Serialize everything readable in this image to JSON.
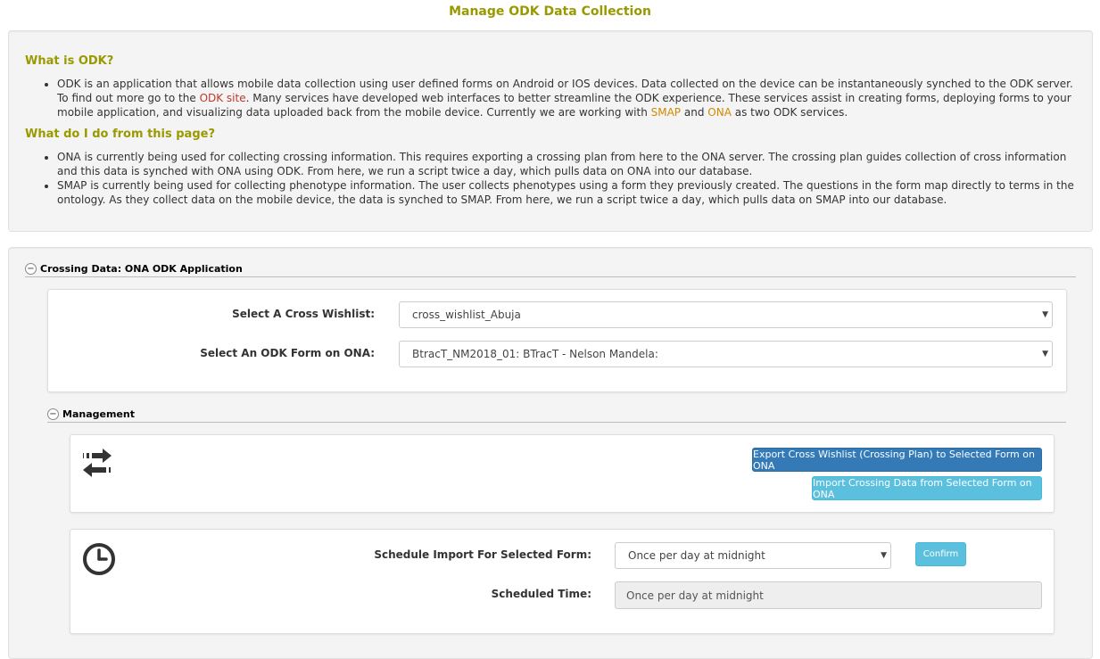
{
  "page": {
    "title": "Manage ODK Data Collection"
  },
  "info": {
    "what_heading": "What is ODK?",
    "odk_intro": "ODK is an application that allows mobile data collection using user defined forms on Android or IOS devices. Data collected on the device can be instantaneously synched to the ODK server. To find out more go to the ",
    "odk_site_link": "ODK site",
    "odk_rest": ". Many services have developed web interfaces to better streamline the ODK experience. These services assist in creating forms, deploying forms to your mobile application, and visualizing data uploaded back from the mobile device. Currently we are working with ",
    "smap_link": "SMAP",
    "and_text": " and ",
    "ona_link": "ONA",
    "services_end": " as two ODK services.",
    "do_heading": "What do I do from this page?",
    "ona_bullet": "ONA is currently being used for collecting crossing information. This requires exporting a crossing plan from here to the ONA server. The crossing plan guides collection of cross information and this data is synched with ONA using ODK. From here, we run a script twice a day, which pulls data on ONA into our database.",
    "smap_bullet": "SMAP is currently being used for collecting phenotype information. The user collects phenotypes using a form they previously created. The questions in the form map directly to terms in the ontology. As they collect data on the mobile device, the data is synched to SMAP. From here, we run a script twice a day, which pulls data on SMAP into our database."
  },
  "crossing": {
    "section_title": "Crossing Data: ONA ODK Application",
    "wishlist_label": "Select A Cross Wishlist:",
    "wishlist_value": "cross_wishlist_Abuja",
    "form_label": "Select An ODK Form on ONA:",
    "form_value": "BtracT_NM2018_01: BTracT - Nelson Mandela:"
  },
  "management": {
    "section_title": "Management",
    "transfer_icon": "transfer-arrows-icon",
    "export_button": "Export Cross Wishlist (Crossing Plan) to Selected Form on ONA",
    "import_button": "Import Crossing Data from Selected Form on ONA",
    "clock_icon": "clock-icon",
    "schedule_label": "Schedule Import For Selected Form:",
    "schedule_value": "Once per day at midnight",
    "confirm_button": "Confirm",
    "scheduled_time_label": "Scheduled Time:",
    "scheduled_time_value": "Once per day at midnight"
  },
  "colors": {
    "heading": "#999900",
    "link": "#d08a00",
    "primary_button": "#337ab7",
    "info_button": "#5bc0de"
  }
}
